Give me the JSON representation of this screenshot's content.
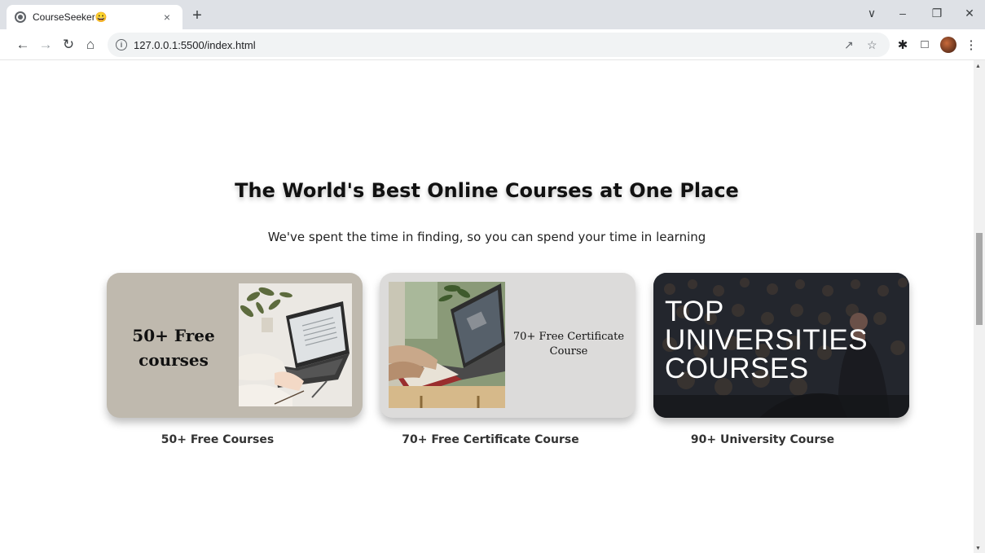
{
  "browser": {
    "tab_title": "CourseSeeker😀",
    "tab_close": "×",
    "new_tab": "+",
    "url": "127.0.0.1:5500/index.html",
    "win_controls": {
      "dropdown": "∨",
      "minimize": "–",
      "restore": "❐",
      "close": "✕"
    }
  },
  "section": {
    "heading": "The World's Best Online Courses at One Place",
    "subheading": "We've spent the time in finding, so you can spend your time in learning"
  },
  "cards": [
    {
      "image_text_line1": "50+ Free",
      "image_text_line2": "courses",
      "caption": "50+ Free Courses"
    },
    {
      "image_text_line1": "70+ Free Certificate",
      "image_text_line2": "Course",
      "caption": "70+ Free Certificate Course"
    },
    {
      "image_text_line1": "TOP",
      "image_text_line2": "UNIVERSITIES",
      "image_text_line3": "COURSES",
      "caption": "90+ University Course"
    }
  ]
}
